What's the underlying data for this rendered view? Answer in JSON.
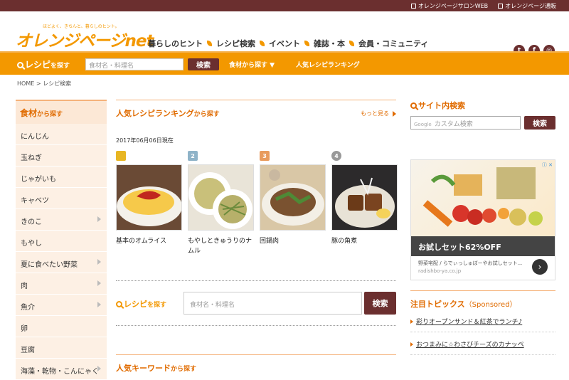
{
  "topbar": {
    "link1": "オレンジページサロンWEB",
    "link2": "オレンジページ通販"
  },
  "header": {
    "logo": "オレンジページnet",
    "tagline": "ほどよく、きちんと、暮らしのヒント。",
    "nav": [
      "暮らしのヒント",
      "レシピ検索",
      "イベント",
      "雑誌・本",
      "会員・コミュニティ"
    ],
    "social": [
      "twitter-icon",
      "facebook-icon",
      "instagram-icon"
    ]
  },
  "search_bar": {
    "title": "レシピ",
    "title_suffix": "を探す",
    "placeholder": "食材名・料理名",
    "button": "検索",
    "by_ingredient": "食材から探す ▼",
    "ranking": "人気レシピランキング"
  },
  "breadcrumb": {
    "home": "HOME",
    "sep": ">",
    "current": "レシピ検索"
  },
  "left_nav": {
    "title": "食材",
    "title_suffix": "から探す",
    "items": [
      {
        "label": "にんじん",
        "arrow": false
      },
      {
        "label": "玉ねぎ",
        "arrow": false
      },
      {
        "label": "じゃがいも",
        "arrow": false
      },
      {
        "label": "キャベツ",
        "arrow": false
      },
      {
        "label": "きのこ",
        "arrow": true
      },
      {
        "label": "もやし",
        "arrow": false
      },
      {
        "label": "夏に食べたい野菜",
        "arrow": true
      },
      {
        "label": "肉",
        "arrow": true
      },
      {
        "label": "魚介",
        "arrow": true
      },
      {
        "label": "卵",
        "arrow": false
      },
      {
        "label": "豆腐",
        "arrow": false
      },
      {
        "label": "海藻・乾物・こんにゃく",
        "arrow": true
      }
    ]
  },
  "ranking": {
    "title": "人気レシピランキング",
    "title_suffix": "から探す",
    "more": "もっと見る",
    "date": "2017年06月06日現在",
    "items": [
      {
        "rank": "",
        "name": "基本のオムライス",
        "badge_color": "#e8b623"
      },
      {
        "rank": "2",
        "name": "もやしときゅうりのナムル",
        "badge_color": "#8fb3c8"
      },
      {
        "rank": "3",
        "name": "回鍋肉",
        "badge_color": "#e89b5d"
      },
      {
        "rank": "4",
        "name": "豚の角煮",
        "badge_color": "#999999"
      }
    ]
  },
  "recipe_search": {
    "title": "レシピ",
    "title_suffix": "を探す",
    "placeholder": "食材名・料理名",
    "button": "検索"
  },
  "keywords": {
    "title": "人気キーワード",
    "title_suffix": "から探す"
  },
  "site_search": {
    "title": "サイト内検索",
    "brand": "Google",
    "placeholder": "カスタム検索",
    "button": "検索"
  },
  "ad": {
    "headline": "お試しセット62%OFF",
    "text": "野菜宅配 / らでぃっしゅぼーやお試しセット...",
    "domain": "radishbo-ya.co.jp",
    "info": "ⓘ ✕"
  },
  "topics": {
    "title": "注目トピックス",
    "sponsored": "（Sponsored）",
    "links": [
      "彩りオープンサンド＆紅茶でランチ♪",
      "おつまみに☆わさびチーズのカナッペ"
    ]
  }
}
